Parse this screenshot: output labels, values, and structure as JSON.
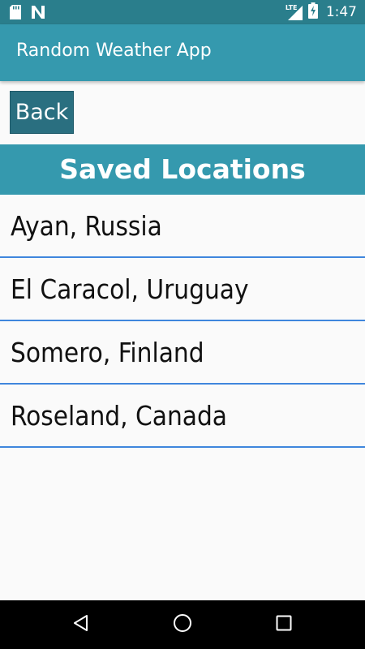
{
  "status_bar": {
    "time": "1:47",
    "network": "LTE",
    "icons": [
      "sd-card-icon",
      "n-notification-icon",
      "lte-signal-icon",
      "battery-charging-icon"
    ]
  },
  "app_bar": {
    "title": "Random Weather App"
  },
  "back_button": {
    "label": "Back"
  },
  "header": {
    "title": "Saved Locations"
  },
  "locations": [
    "Ayan, Russia",
    "El Caracol, Uruguay",
    "Somero, Finland",
    "Roseland, Canada"
  ],
  "nav_bar": {
    "icons": [
      "back-triangle-icon",
      "home-circle-icon",
      "recents-square-icon"
    ]
  },
  "colors": {
    "status_bar": "#2a7e8c",
    "primary": "#3599ae",
    "button": "#2a6f80",
    "divider": "#3f86dd",
    "background": "#fafafa"
  }
}
